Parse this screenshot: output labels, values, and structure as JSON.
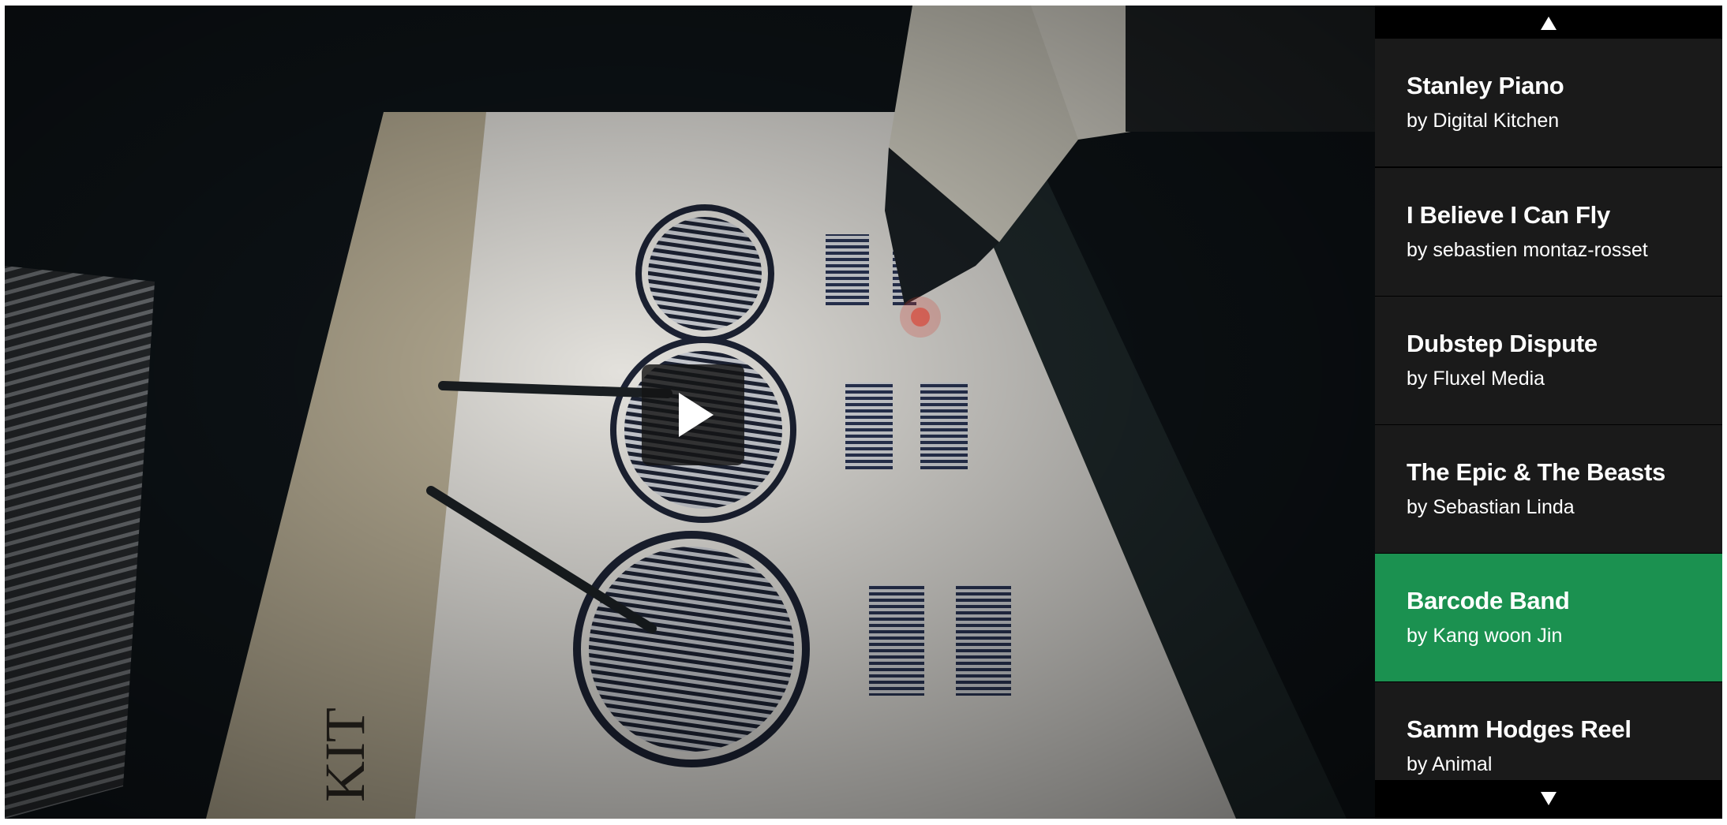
{
  "player": {
    "video_scene": "barcode-music-board",
    "play_icon": "play-icon"
  },
  "playlist": {
    "scroll_up_icon": "arrow-up-icon",
    "scroll_down_icon": "arrow-down-icon",
    "active_color": "#1b9150",
    "items": [
      {
        "title": "Stanley Piano",
        "byline": "by Digital Kitchen",
        "active": false
      },
      {
        "title": "I Believe I Can Fly",
        "byline": "by sebastien montaz-rosset",
        "active": false
      },
      {
        "title": "Dubstep Dispute",
        "byline": "by Fluxel Media",
        "active": false
      },
      {
        "title": "The Epic & The Beasts",
        "byline": "by Sebastian Linda",
        "active": false
      },
      {
        "title": "Barcode Band",
        "byline": "by Kang woon Jin",
        "active": true
      },
      {
        "title": "Samm Hodges Reel",
        "byline": "by Animal",
        "active": false
      }
    ]
  }
}
